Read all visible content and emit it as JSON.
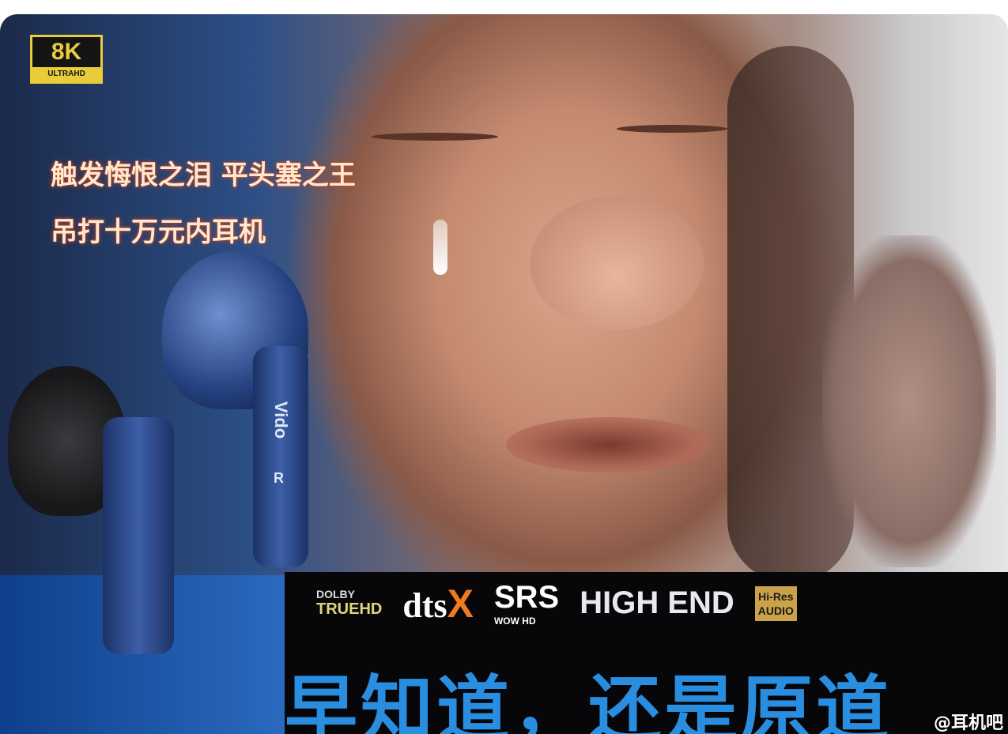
{
  "badge": {
    "main": "8K",
    "sub": "ULTRAHD"
  },
  "caption": {
    "line1": "触发悔恨之泪 平头塞之王",
    "line2": "吊打十万元内耳机"
  },
  "earbud": {
    "brand": "Vido",
    "side": "R"
  },
  "logos": {
    "dolby_top": "DOLBY",
    "dolby_bottom": "TRUEHD",
    "dts": "dts",
    "dts_x": "X",
    "srs": "SRS",
    "srs_sub": "WOW HD",
    "high_end": "HIGH END",
    "hires_top": "Hi-Res",
    "hires_bottom": "AUDIO"
  },
  "slogan": "早知道，还是原道",
  "watermark": "@耳机吧",
  "colors": {
    "slogan": "#2a8ee0",
    "badge": "#e8cc3a",
    "band": "#07070a"
  }
}
